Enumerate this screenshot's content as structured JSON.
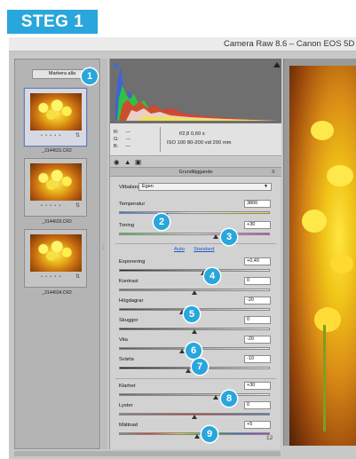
{
  "step_banner": "STEG 1",
  "window": {
    "title": "Camera Raw 8.6  –  Canon EOS 5D"
  },
  "filmstrip": {
    "mark_all": "Markera alla",
    "items": [
      {
        "file": "_3144631.CR2",
        "dots": "• • • • •"
      },
      {
        "file": "_3144633.CR2",
        "dots": "• • • • •"
      },
      {
        "file": "_3144634.CR2",
        "dots": "• • • • •"
      }
    ]
  },
  "info": {
    "r_label": "R:",
    "g_label": "G:",
    "b_label": "B:",
    "r_value": "---",
    "g_value": "---",
    "b_value": "---",
    "aperture_shutter": "f/2,8   0,60 s",
    "iso_lens": "ISO 100   80-200 vid 200 mm"
  },
  "panel": {
    "section_title": "Grundläggande",
    "white_balance_label": "Vitbalans:",
    "white_balance_value": "Egen",
    "auto_link": "Auto",
    "standard_link": "Standard",
    "sliders": [
      {
        "label": "Temperatur",
        "value": "3800",
        "position": 0.32
      },
      {
        "label": "Toning",
        "value": "+30",
        "position": 0.64
      },
      {
        "label": "Exponering",
        "value": "+0,40",
        "position": 0.56
      },
      {
        "label": "Kontrast",
        "value": "0",
        "position": 0.5
      },
      {
        "label": "Högdagrar",
        "value": "-20",
        "position": 0.42
      },
      {
        "label": "Skuggor",
        "value": "0",
        "position": 0.5
      },
      {
        "label": "Vita",
        "value": "-20",
        "position": 0.42
      },
      {
        "label": "Svärta",
        "value": "-10",
        "position": 0.46
      },
      {
        "label": "Klarhet",
        "value": "+30",
        "position": 0.64
      },
      {
        "label": "Lyster",
        "value": "0",
        "position": 0.5
      },
      {
        "label": "Mättnad",
        "value": "+5",
        "position": 0.52
      }
    ]
  },
  "status": {
    "page_indicator": "12"
  },
  "badges": [
    "1",
    "2",
    "3",
    "4",
    "5",
    "6",
    "7",
    "8",
    "9"
  ],
  "colors": {
    "accent": "#29a6dc",
    "link": "#2456c6"
  }
}
